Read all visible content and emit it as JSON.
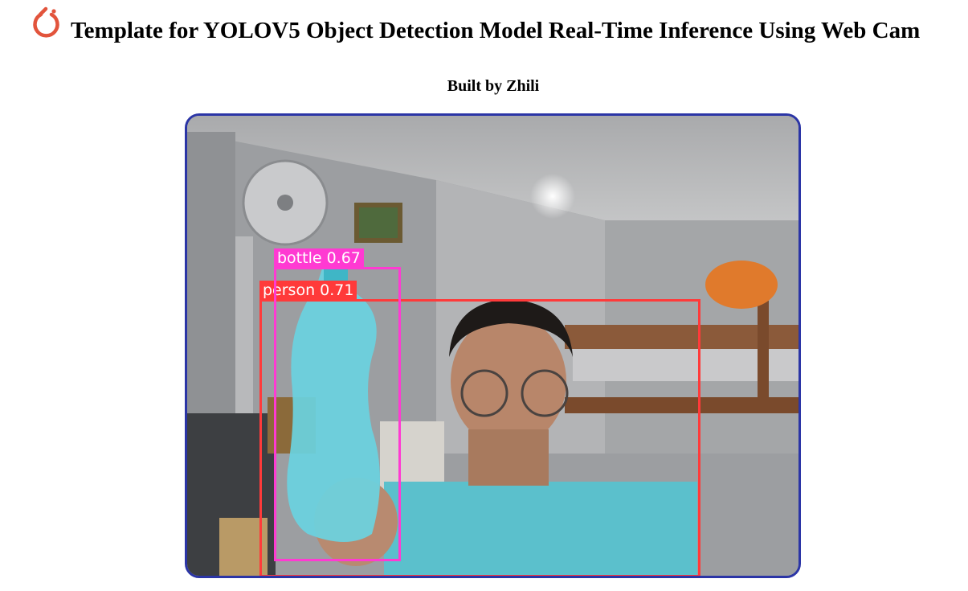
{
  "header": {
    "logo_icon": "pytorch-logo-icon",
    "title": "Template for YOLOV5 Object Detection Model Real-Time Inference Using Web Cam",
    "subtitle": "Built by Zhili"
  },
  "video": {
    "border_color": "#2b35a6",
    "detections": [
      {
        "label": "person 0.71",
        "color": "#ff3a3a"
      },
      {
        "label": "bottle 0.67",
        "color": "#ff3ad2"
      }
    ]
  }
}
